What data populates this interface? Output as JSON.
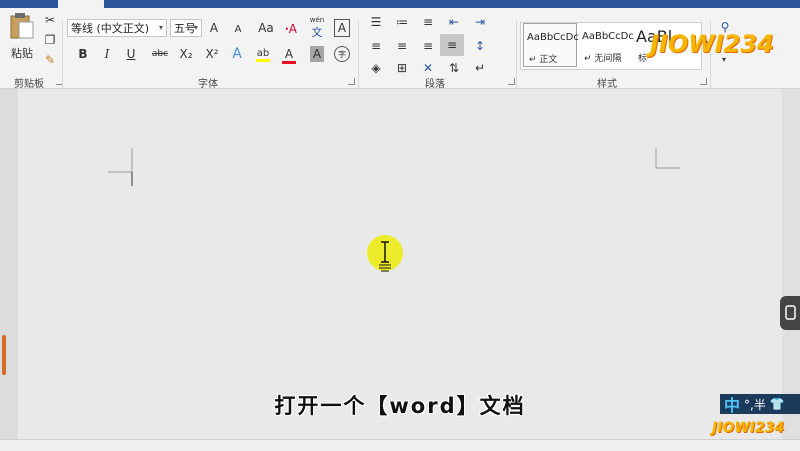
{
  "clipboard": {
    "paste_label": "粘贴",
    "group_label": "剪贴板"
  },
  "font": {
    "family_value": "等线 (中文正文)",
    "size_value": "五号",
    "group_label": "字体",
    "grow_label": "A",
    "shrink_label": "A",
    "case_label": "Aa",
    "phonetic_label": "wén",
    "phonetic_char": "文",
    "border_label": "A",
    "bold_label": "B",
    "italic_label": "I",
    "underline_label": "U",
    "strike_label": "abc",
    "subscript_label": "X₂",
    "superscript_label": "X²",
    "effects_label": "A",
    "color_label": "A",
    "shading_label": "A",
    "encircle_label": "字"
  },
  "paragraph": {
    "group_label": "段落"
  },
  "styles": {
    "group_label": "样式",
    "items": [
      {
        "sample": "AaBbCcDc",
        "name": "↵ 正文"
      },
      {
        "sample": "AaBbCcDc",
        "name": "↵ 无间隔"
      },
      {
        "sample": "AaBl",
        "name": "标"
      }
    ]
  },
  "subtitle": "打开一个【word】文档",
  "ime": {
    "mode": "中",
    "symbols": "°,半"
  },
  "watermark": "JIOWI234"
}
